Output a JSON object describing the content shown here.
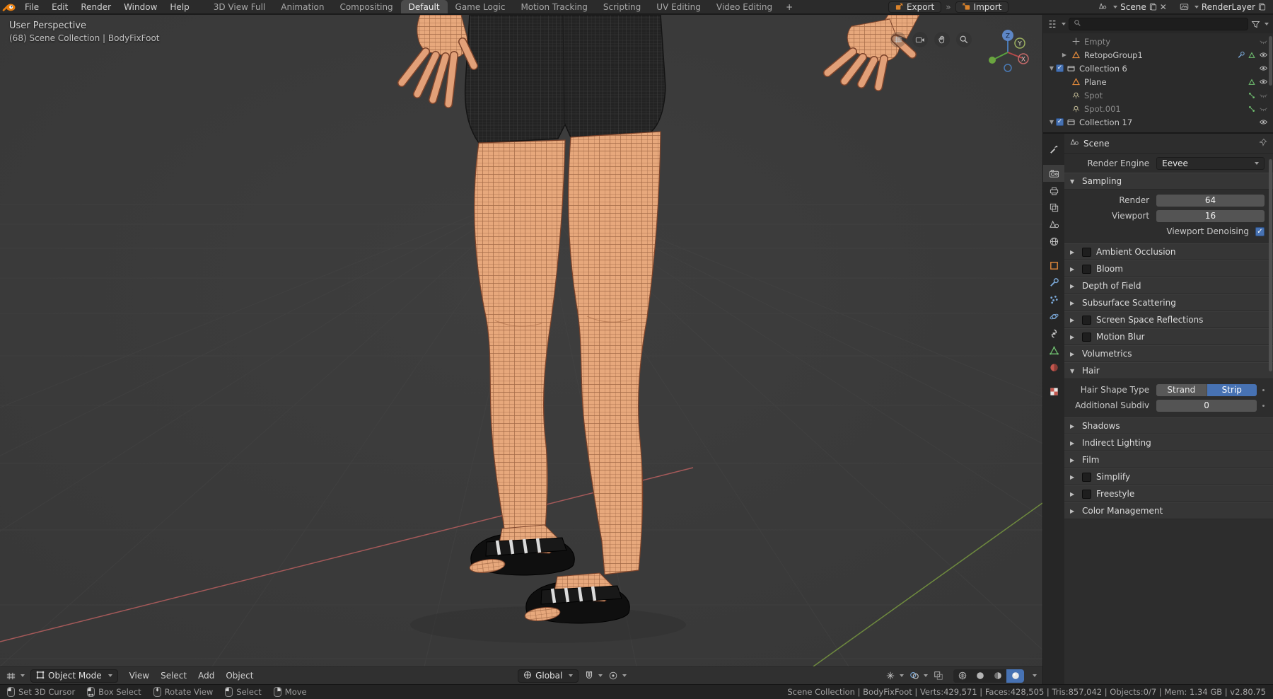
{
  "accent": {
    "blue": "#4772b3",
    "orange": "#e0883a"
  },
  "topbar": {
    "app_menus": [
      "File",
      "Edit",
      "Render",
      "Window",
      "Help"
    ],
    "workspaces": [
      "3D View Full",
      "Animation",
      "Compositing",
      "Default",
      "Game Logic",
      "Motion Tracking",
      "Scripting",
      "UV Editing",
      "Video Editing"
    ],
    "active_workspace": "Default",
    "add_workspace_label": "+",
    "export_label": "Export",
    "import_label": "Import",
    "scene": {
      "value": "Scene"
    },
    "render_layer": {
      "value": "RenderLayer"
    }
  },
  "viewport": {
    "overlay": {
      "line1": "User Perspective",
      "line2": "(68) Scene Collection | BodyFixFoot"
    },
    "gizmo": {
      "axes": [
        "Z",
        "Y",
        "X"
      ]
    },
    "header": {
      "mode": "Object Mode",
      "menus": [
        "View",
        "Select",
        "Add",
        "Object"
      ],
      "orientation": "Global"
    }
  },
  "outliner": {
    "rows": [
      {
        "label": "Empty",
        "depth": 1,
        "icon": "empty",
        "dim": true,
        "eye": "closed"
      },
      {
        "label": "RetopoGroup1",
        "depth": 1,
        "icon": "mesh",
        "expander": "closed",
        "extras": [
          "modifier",
          "mesh-data"
        ],
        "eye": "open"
      },
      {
        "label": "Collection 6",
        "depth": 0,
        "icon": "collection",
        "checkbox": true,
        "checked": true,
        "expander": "open",
        "eye": "open"
      },
      {
        "label": "Plane",
        "depth": 1,
        "icon": "mesh",
        "extras": [
          "mesh-data"
        ],
        "eye": "open"
      },
      {
        "label": "Spot",
        "depth": 1,
        "icon": "light",
        "dim": true,
        "extras": [
          "nodetree"
        ],
        "eye": "closed"
      },
      {
        "label": "Spot.001",
        "depth": 1,
        "icon": "light",
        "dim": true,
        "extras": [
          "nodetree"
        ],
        "eye": "closed"
      },
      {
        "label": "Collection 17",
        "depth": 0,
        "icon": "collection",
        "checkbox": true,
        "checked": true,
        "expander": "open",
        "eye": "open"
      }
    ]
  },
  "properties": {
    "breadcrumb": "Scene",
    "render_engine": {
      "label": "Render Engine",
      "value": "Eevee"
    },
    "tabs": [
      "tool",
      "render",
      "output",
      "view-layer",
      "scene",
      "world",
      "object",
      "modifiers",
      "particles",
      "physics",
      "constraints",
      "object-data",
      "material",
      "texture"
    ],
    "active_tab": "render",
    "sections": [
      {
        "title": "Sampling",
        "expanded": true,
        "rows": [
          {
            "type": "number",
            "label": "Render",
            "value": "64",
            "wide": true
          },
          {
            "type": "number",
            "label": "Viewport",
            "value": "16",
            "wide": true
          },
          {
            "type": "checkbox",
            "label": "Viewport Denoising",
            "checked": true
          }
        ]
      },
      {
        "title": "Ambient Occlusion",
        "expanded": false,
        "checkbox": true,
        "checked": false
      },
      {
        "title": "Bloom",
        "expanded": false,
        "checkbox": true,
        "checked": false
      },
      {
        "title": "Depth of Field",
        "expanded": false
      },
      {
        "title": "Subsurface Scattering",
        "expanded": false
      },
      {
        "title": "Screen Space Reflections",
        "expanded": false,
        "checkbox": true,
        "checked": false
      },
      {
        "title": "Motion Blur",
        "expanded": false,
        "checkbox": true,
        "checked": false
      },
      {
        "title": "Volumetrics",
        "expanded": false
      },
      {
        "title": "Hair",
        "expanded": true,
        "rows": [
          {
            "type": "segmented",
            "label": "Hair Shape Type",
            "options": [
              "Strand",
              "Strip"
            ],
            "active": "Strip"
          },
          {
            "type": "number",
            "label": "Additional Subdiv",
            "value": "0"
          }
        ]
      },
      {
        "title": "Shadows",
        "expanded": false
      },
      {
        "title": "Indirect Lighting",
        "expanded": false
      },
      {
        "title": "Film",
        "expanded": false
      },
      {
        "title": "Simplify",
        "expanded": false,
        "checkbox": true,
        "checked": false
      },
      {
        "title": "Freestyle",
        "expanded": false,
        "checkbox": true,
        "checked": false
      },
      {
        "title": "Color Management",
        "expanded": false
      }
    ]
  },
  "statusbar": {
    "hints": [
      {
        "icon": "mouse-left",
        "label": "Set 3D Cursor"
      },
      {
        "icon": "mouse-left-drag",
        "label": "Box Select"
      },
      {
        "icon": "mouse-middle",
        "label": "Rotate View"
      },
      {
        "icon": "mouse-left",
        "label": "Select"
      },
      {
        "icon": "mouse-right",
        "label": "Move"
      }
    ],
    "stats": "Scene Collection | BodyFixFoot | Verts:429,571 | Faces:428,505 | Tris:857,042 | Objects:0/7 | Mem: 1.34 GB | v2.80.75"
  }
}
